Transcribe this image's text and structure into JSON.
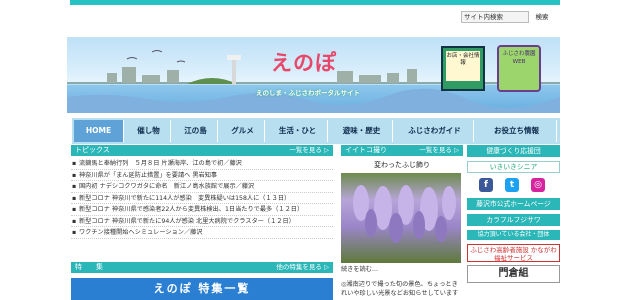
{
  "search": {
    "placeholder": "サイト内検索",
    "button": "検索"
  },
  "banner": {
    "logo": "えのぽ",
    "tagline": "えのしま・ふじさわポータルサイト",
    "badge1": "お店・会社情報",
    "badge2": "ふじさわ農園WEB"
  },
  "nav": {
    "items": [
      {
        "label": "HOME",
        "active": true
      },
      {
        "label": "催し物"
      },
      {
        "label": "江の島"
      },
      {
        "label": "グルメ"
      },
      {
        "label": "生活・ひと"
      },
      {
        "label": "遊味・歴史"
      },
      {
        "label": "ふじさわガイド"
      },
      {
        "label": "お役立ち情報"
      }
    ]
  },
  "topics": {
    "title": "トピックス",
    "more": "一覧を見る ▷",
    "items": [
      "流鏑馬と奉納行列　５月８日 片瀬海岸、江の島で初／藤沢",
      "神奈川県が「まん延防止措置」を要請へ 黒岩知事",
      "国内初 ナデシコクワガタに命名　新江ノ島水族館で展示／藤沢",
      "新型コロナ 神奈川で新たに114人が感染　変異株疑いは158人に（１３日）",
      "新型コロナ 神奈川県で感染者22人から変異株検出、1日当たりで最多（１２日）",
      "新型コロナ 神奈川県で新たに94人が感染 北里大病院でクラスター（１２日）",
      "ワクチン接種開始へシミュレーション／藤沢"
    ]
  },
  "feature": {
    "title": "特　　集",
    "more": "他の特集を見る ▷",
    "banner": "えのぽ 特集一覧"
  },
  "photo": {
    "header": "イイトコ撮り",
    "more": "一覧を見る ▷",
    "title": "変わったふじ飾り",
    "caption": "続きを読む…",
    "text": "◎湘南辺りで撮った旬の景色、ちょっときれいや珍しい光景などお知らせしています"
  },
  "sidebar": {
    "health": "健康づくり応援団",
    "senior": "いきいきシニア",
    "city": "藤沢市公式ホームページ",
    "colorful": "カラフルフジサワ",
    "partners": "協力頂いている会社・団体",
    "ad1": "ふじさわ高齢者施設 かながわ福祉サービス",
    "ad2": "門倉組"
  },
  "colors": {
    "accent": "#2bb6b8",
    "navbg": "#b8dff0",
    "navactive": "#5fa2d8"
  }
}
